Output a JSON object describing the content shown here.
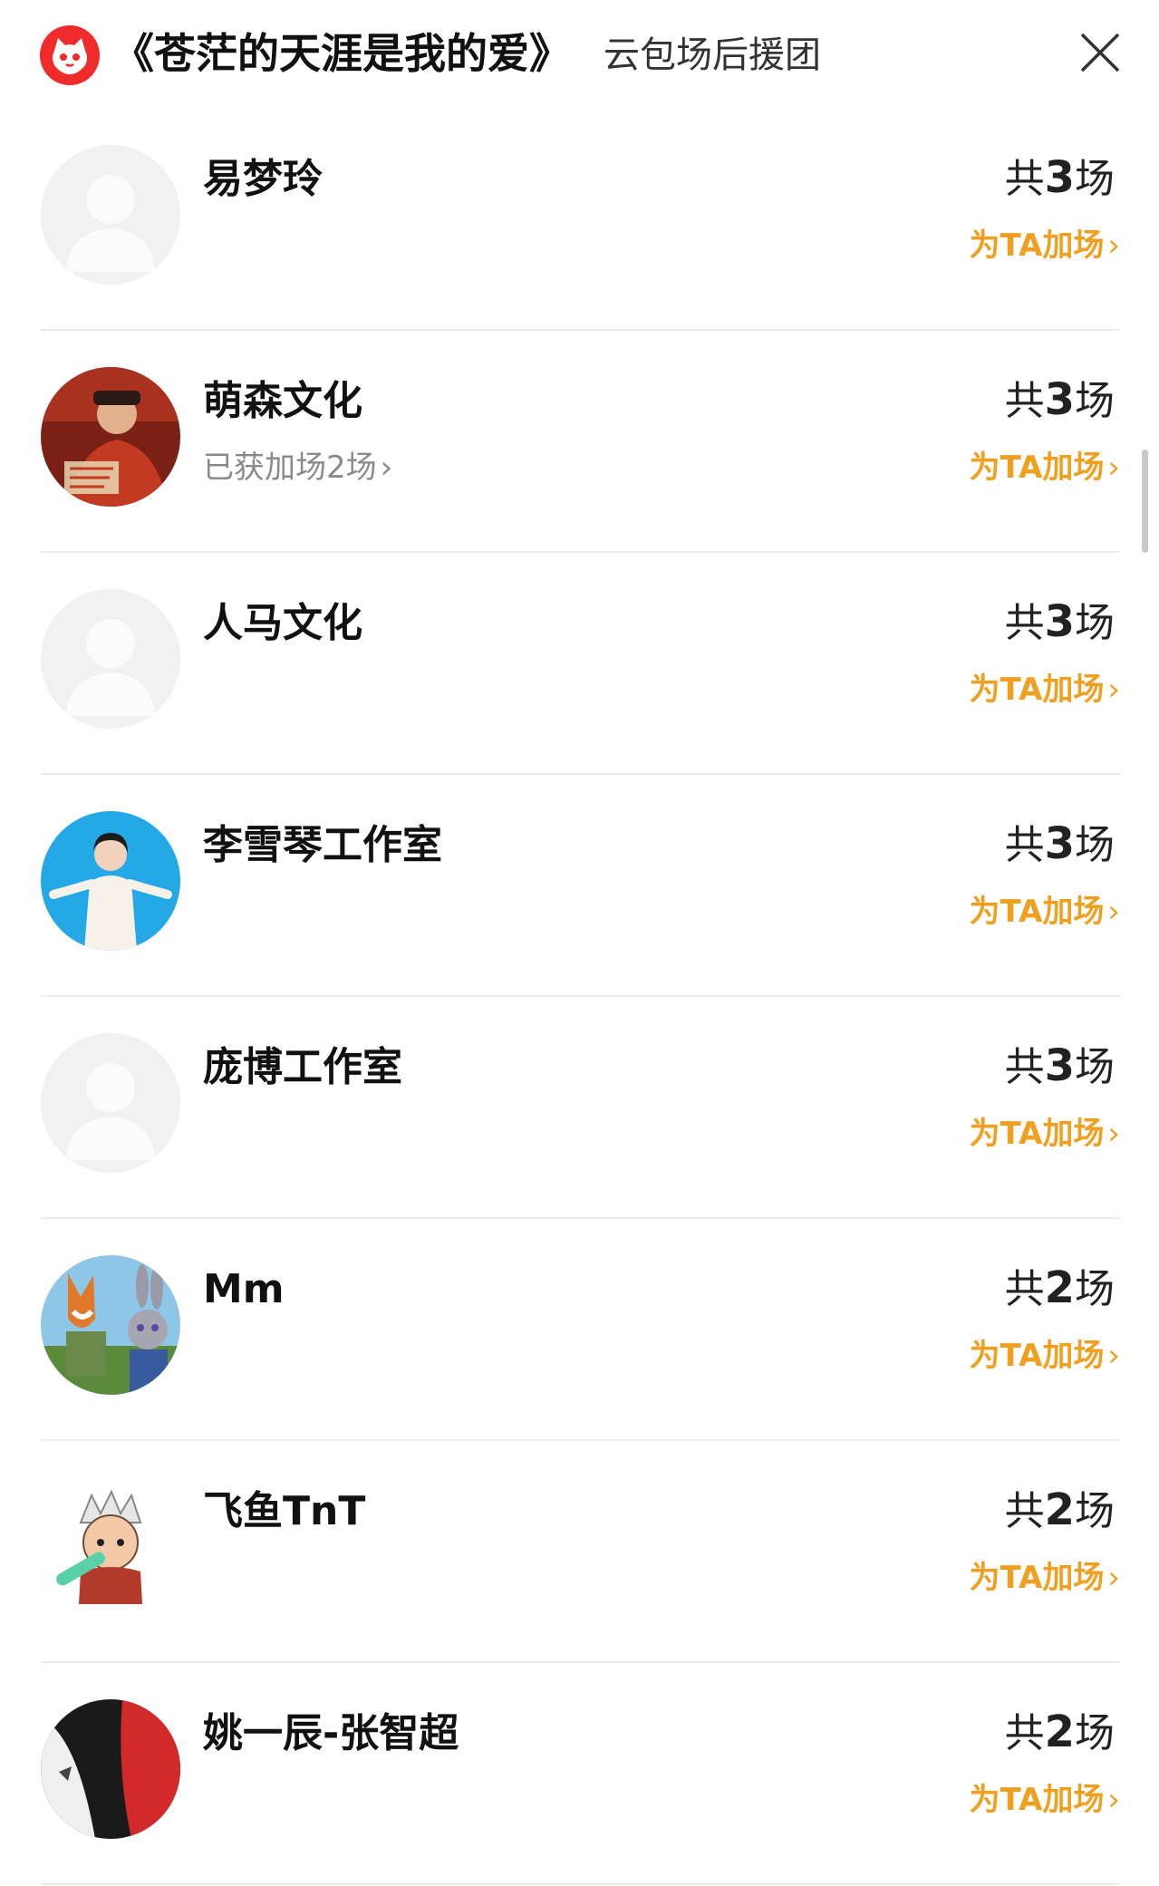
{
  "header": {
    "title": "《苍茫的天涯是我的爱》",
    "subtitle": "云包场后援团",
    "logo": "cat-logo-icon",
    "close_icon": "close-icon"
  },
  "colors": {
    "accent": "#f0a020",
    "brand": "#ef2b2b",
    "muted": "#8a8a8a"
  },
  "rows": [
    {
      "name": "易梦玲",
      "count_prefix": "共",
      "count_num": "3",
      "count_suffix": "场",
      "bonus": "",
      "cta": "为TA加场",
      "avatar": "default-avatar-icon"
    },
    {
      "name": "萌森文化",
      "count_prefix": "共",
      "count_num": "3",
      "count_suffix": "场",
      "bonus": "已获加场2场",
      "cta": "为TA加场",
      "avatar": "movie-poster-avatar"
    },
    {
      "name": "人马文化",
      "count_prefix": "共",
      "count_num": "3",
      "count_suffix": "场",
      "bonus": "",
      "cta": "为TA加场",
      "avatar": "default-avatar-icon"
    },
    {
      "name": "李雪琴工作室",
      "count_prefix": "共",
      "count_num": "3",
      "count_suffix": "场",
      "bonus": "",
      "cta": "为TA加场",
      "avatar": "person-photo-avatar"
    },
    {
      "name": "庞博工作室",
      "count_prefix": "共",
      "count_num": "3",
      "count_suffix": "场",
      "bonus": "",
      "cta": "为TA加场",
      "avatar": "default-avatar-icon"
    },
    {
      "name": "Mm",
      "count_prefix": "共",
      "count_num": "2",
      "count_suffix": "场",
      "bonus": "",
      "cta": "为TA加场",
      "avatar": "cartoon-fox-rabbit-avatar"
    },
    {
      "name": "飞鱼TnT",
      "count_prefix": "共",
      "count_num": "2",
      "count_suffix": "场",
      "bonus": "",
      "cta": "为TA加场",
      "avatar": "cartoon-character-avatar"
    },
    {
      "name": "姚一辰-张智超",
      "count_prefix": "共",
      "count_num": "2",
      "count_suffix": "场",
      "bonus": "",
      "cta": "为TA加场",
      "avatar": "clothing-photo-avatar"
    }
  ]
}
